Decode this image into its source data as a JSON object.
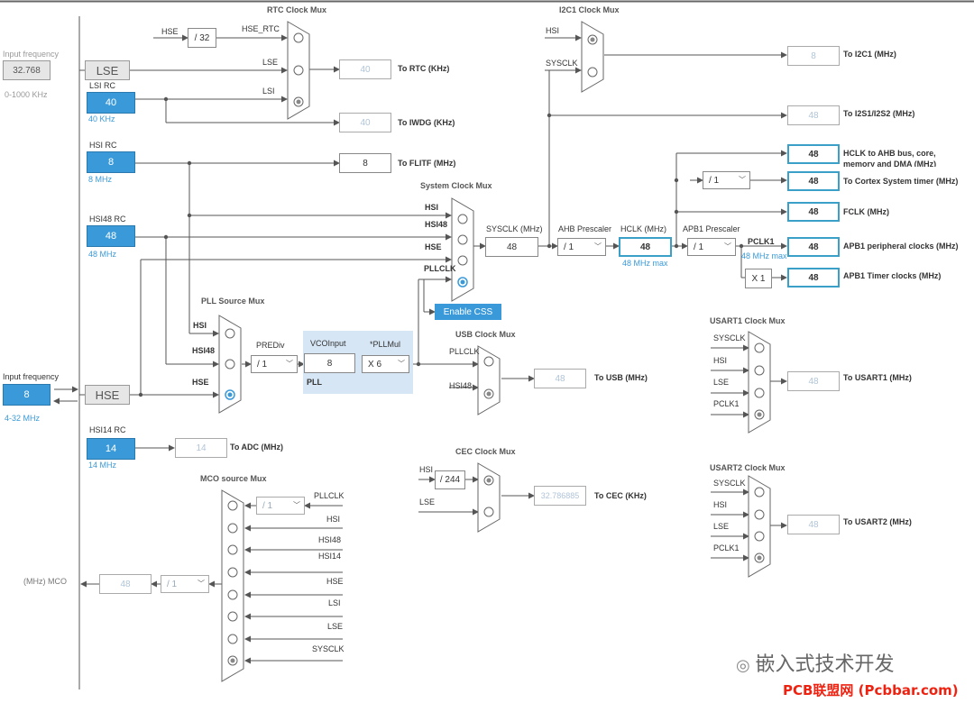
{
  "sources": {
    "lse_input_label": "Input frequency",
    "lse_input_value": "32.768",
    "lse_range": "0-1000 KHz",
    "lse": "LSE",
    "lsi_label": "LSI RC",
    "lsi_value": "40",
    "lsi_sub": "40 KHz",
    "hsi_label": "HSI RC",
    "hsi_value": "8",
    "hsi_sub": "8 MHz",
    "hsi48_label": "HSI48 RC",
    "hsi48_value": "48",
    "hsi48_sub": "48 MHz",
    "hse_input_label": "Input frequency",
    "hse_input_value": "8",
    "hse_range": "4-32 MHz",
    "hse": "HSE",
    "hsi14_label": "HSI14 RC",
    "hsi14_value": "14",
    "hsi14_sub": "14 MHz"
  },
  "rtc": {
    "title": "RTC Clock Mux",
    "hse": "HSE",
    "div": "/ 32",
    "hse_rtc": "HSE_RTC",
    "lse": "LSE",
    "lsi": "LSI",
    "rtc_value": "40",
    "rtc_label": "To RTC (KHz)",
    "iwdg_value": "40",
    "iwdg_label": "To IWDG (KHz)"
  },
  "flitf": {
    "value": "8",
    "label": "To FLITF (MHz)"
  },
  "i2c1": {
    "title": "I2C1 Clock Mux",
    "hsi": "HSI",
    "sysclk": "SYSCLK",
    "value": "8",
    "label": "To I2C1 (MHz)",
    "i2s_value": "48",
    "i2s_label": "To I2S1/I2S2 (MHz)"
  },
  "sysmux": {
    "title": "System Clock Mux",
    "hsi": "HSI",
    "hsi48": "HSI48",
    "hse": "HSE",
    "pllclk": "PLLCLK",
    "enable_css": "Enable CSS"
  },
  "bus": {
    "sysclk_label": "SYSCLK (MHz)",
    "sysclk_value": "48",
    "ahb_label": "AHB Prescaler",
    "ahb_value": "/ 1",
    "hclk_label": "HCLK (MHz)",
    "hclk_value": "48",
    "hclk_max": "48 MHz max",
    "apb1_label": "APB1 Prescaler",
    "apb1_value": "/ 1",
    "pclk1_label": "PCLK1",
    "pclk1_max": "48 MHz max",
    "cortex_div": "/ 1",
    "x1": "X 1"
  },
  "outputs": {
    "hclk_ahb_value": "48",
    "hclk_ahb_label": "HCLK to AHB bus, core, memory and DMA (MHz)",
    "cortex_value": "48",
    "cortex_label": "To Cortex System timer (MHz)",
    "fclk_value": "48",
    "fclk_label": "FCLK (MHz)",
    "apb1_periph_value": "48",
    "apb1_periph_label": "APB1 peripheral clocks (MHz)",
    "apb1_timer_value": "48",
    "apb1_timer_label": "APB1 Timer clocks (MHz)"
  },
  "pll": {
    "src_title": "PLL Source Mux",
    "hsi": "HSI",
    "hsi48": "HSI48",
    "hse": "HSE",
    "prediv_label": "PREDiv",
    "prediv_value": "/ 1",
    "vco_label": "VCOInput",
    "vco_value": "8",
    "mul_label": "*PLLMul",
    "mul_value": "X 6",
    "pll_label": "PLL"
  },
  "usb": {
    "title": "USB Clock Mux",
    "pllclk": "PLLCLK",
    "hsi48": "HSI48",
    "value": "48",
    "label": "To USB (MHz)"
  },
  "adc": {
    "value": "14",
    "label": "To ADC (MHz)"
  },
  "cec": {
    "title": "CEC Clock Mux",
    "hsi": "HSI",
    "div": "/ 244",
    "lse": "LSE",
    "value": "32.786885",
    "label": "To CEC (KHz)"
  },
  "usart1": {
    "title": "USART1 Clock Mux",
    "inputs": [
      "SYSCLK",
      "HSI",
      "LSE",
      "PCLK1"
    ],
    "value": "48",
    "label": "To USART1 (MHz)"
  },
  "usart2": {
    "title": "USART2 Clock Mux",
    "inputs": [
      "SYSCLK",
      "HSI",
      "LSE",
      "PCLK1"
    ],
    "value": "48",
    "label": "To USART2 (MHz)"
  },
  "mco": {
    "title": "MCO source Mux",
    "div_pll": "/ 1",
    "inputs": [
      "PLLCLK",
      "HSI",
      "HSI48",
      "HSI14",
      "HSE",
      "LSI",
      "LSE",
      "SYSCLK"
    ],
    "out_label": "(MHz) MCO",
    "out_value": "48",
    "out_div": "/ 1"
  },
  "watermark": {
    "wechat": "嵌入式技术开发",
    "site": "PCB联盟网 (Pcbbar.com)"
  },
  "colors": {
    "accent": "#3a9ad9",
    "line": "#555555",
    "highlight": "#3aa0c8",
    "pll_panel": "#d6e6f4"
  }
}
